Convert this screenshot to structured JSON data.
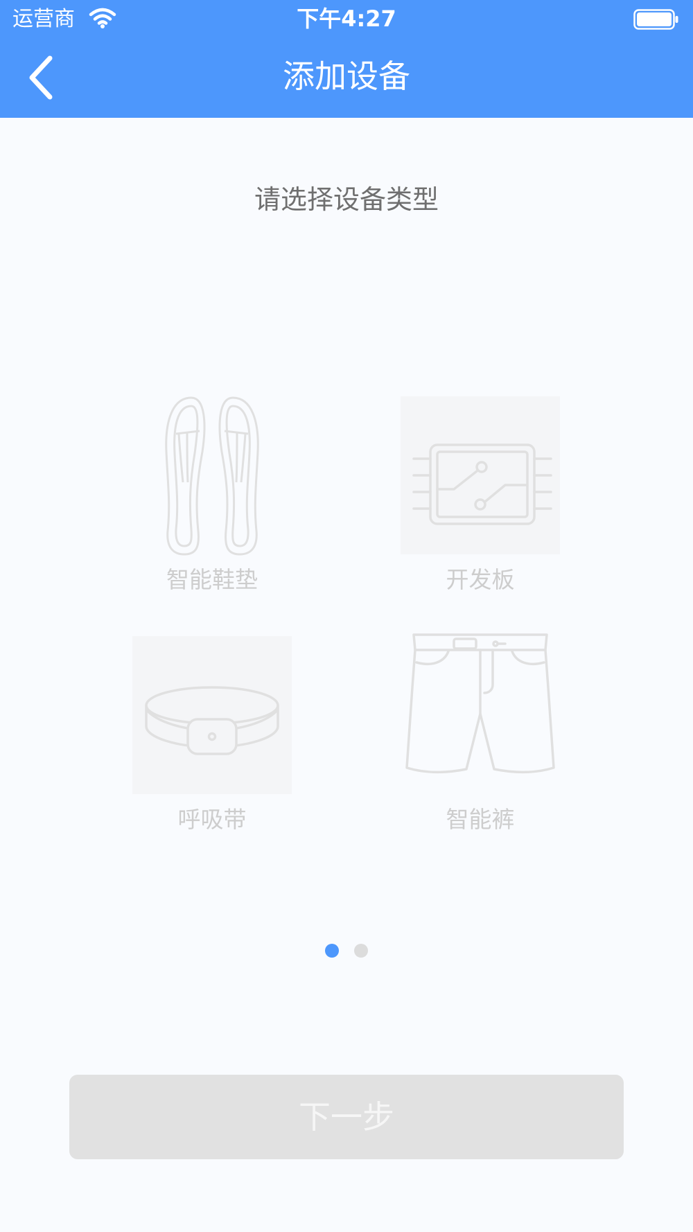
{
  "status_bar": {
    "carrier": "运营商",
    "time": "下午4:27",
    "wifi_icon": "wifi-icon",
    "battery_icon": "battery-full-icon"
  },
  "nav": {
    "back_icon": "chevron-left-icon",
    "title": "添加设备"
  },
  "prompt": "请选择设备类型",
  "devices": [
    {
      "label": "智能鞋垫",
      "icon": "insoles-icon"
    },
    {
      "label": "开发板",
      "icon": "circuit-board-icon"
    },
    {
      "label": "呼吸带",
      "icon": "breathing-belt-icon"
    },
    {
      "label": "智能裤",
      "icon": "smart-shorts-icon"
    }
  ],
  "pager": {
    "total": 2,
    "current": 1
  },
  "next_button": {
    "label": "下一步",
    "enabled": false
  },
  "colors": {
    "accent": "#4d97fc",
    "background": "#f9fbfe",
    "disabled_button": "#e1e1e1",
    "icon_stroke": "#e0e0e0",
    "label_gray": "#cdcdcd"
  }
}
